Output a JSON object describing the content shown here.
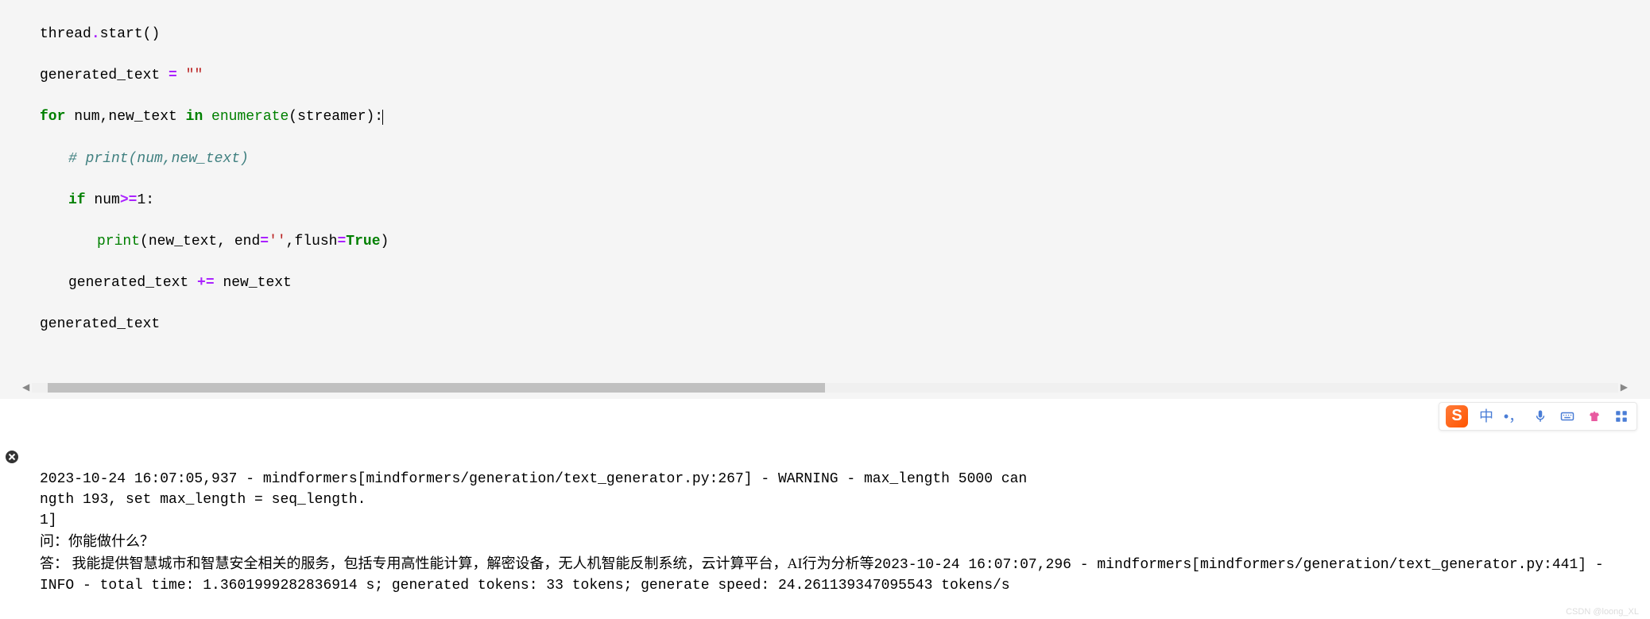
{
  "code": {
    "line1_prefix": "thread",
    "line1_dot": ".",
    "line1_method": "start",
    "line1_paren": "()",
    "line2_var": "generated_text ",
    "line2_op": "=",
    "line2_str": " \"\"",
    "line3_for": "for",
    "line3_mid": " num,new_text ",
    "line3_in": "in",
    "line3_enum": " enumerate",
    "line3_tail": "(streamer):",
    "line4_comment": "# print(num,new_text)",
    "line5_if": "if",
    "line5_cond": " num",
    "line5_op": ">=",
    "line5_tail": "1",
    "line5_colon": ":",
    "line6_print": "print",
    "line6_open": "(new_text, end",
    "line6_eq": "=",
    "line6_str": "''",
    "line6_flush": ",flush",
    "line6_eq2": "=",
    "line6_true": "True",
    "line6_close": ")",
    "line7_var": "generated_text ",
    "line7_op": "+=",
    "line7_tail": " new_text",
    "line8": "generated_text"
  },
  "output": {
    "log1": "2023-10-24 16:07:05,937 - mindformers[mindformers/generation/text_generator.py:267] - WARNING - max_length 5000 can ",
    "log2": "ngth 193, set max_length = seq_length.",
    "log3": "1]",
    "question_label": "问：",
    "question_text": "你能做什么？",
    "answer_label": "答： ",
    "answer_text": "我能提供智慧城市和智慧安全相关的服务，包括专用高性能计算，解密设备，无人机智能反制系统，云计算平台，AI行为分析等",
    "log4": "2023-10-24 16:07:07,296 - mindformers[mindformers/generation/text_generator.py:441] - INFO - total time: 1.3601999282836914 s; generated tokens: 33 tokens; generate speed: 24.261139347095543 tokens/s"
  },
  "ime": {
    "logo": "S",
    "lang": "中"
  },
  "watermark": "CSDN @loong_XL"
}
